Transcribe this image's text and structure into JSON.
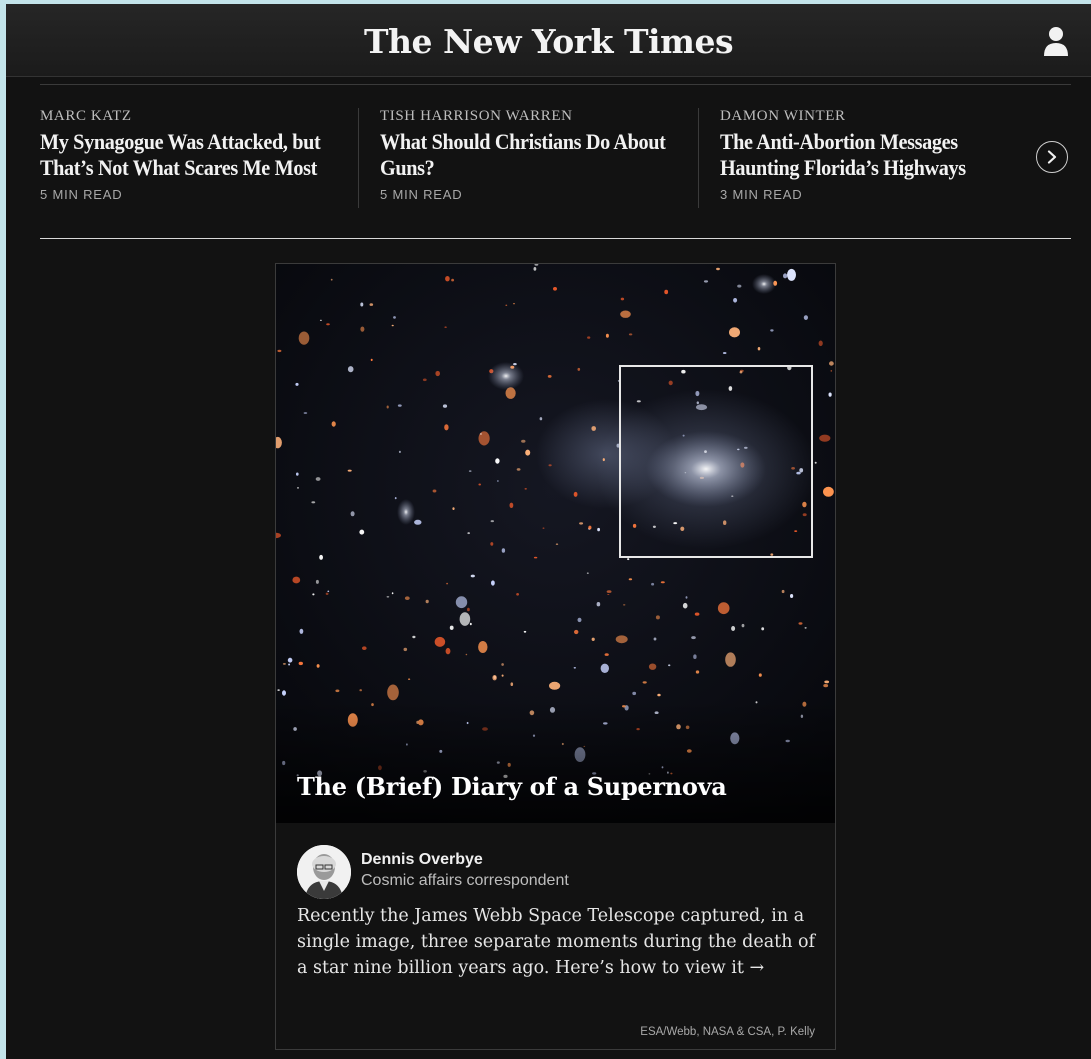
{
  "header": {
    "logo_text": "The New York Times",
    "account_icon": "user-account-icon"
  },
  "opinion_strip": {
    "stories": [
      {
        "author": "MARC KATZ",
        "headline": "My Synagogue Was Attacked, but That’s Not What Scares Me Most",
        "read_time": "5 MIN READ"
      },
      {
        "author": "TISH HARRISON WARREN",
        "headline": "What Should Christians Do About Guns?",
        "read_time": "5 MIN READ"
      },
      {
        "author": "DAMON WINTER",
        "headline": "The Anti-Abortion Messages Haunting Florida’s Highways",
        "read_time": "3 MIN READ"
      }
    ],
    "next_icon": "chevron-right-icon"
  },
  "feature": {
    "title": "The (Brief) Diary of a Supernova",
    "author_name": "Dennis Overbye",
    "author_role": "Cosmic affairs correspondent",
    "summary": "Recently the James Webb Space Telescope captured, in a single image, three separate moments during the death of a star nine billion years ago. Here’s how to view it →",
    "credit": "ESA/Webb, NASA & CSA, P. Kelly"
  },
  "colors": {
    "page_background": "#121212",
    "header_background": "#222222",
    "outer_background": "#c3e4ea",
    "highlight_box": "#e8e8e8"
  }
}
